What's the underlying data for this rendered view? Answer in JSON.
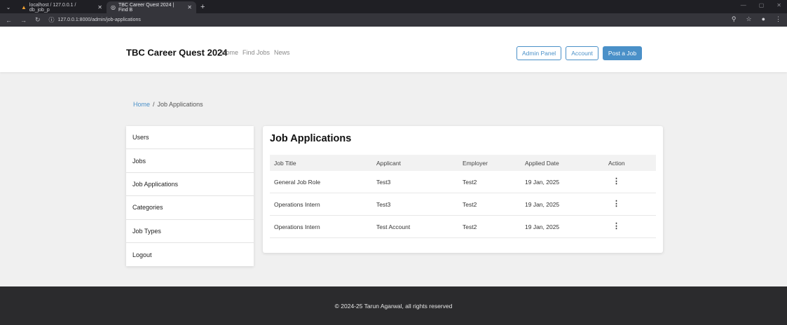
{
  "browser": {
    "tabs": [
      {
        "title": "localhost / 127.0.0.1 / db_job_p",
        "icon": "phpmyadmin-icon"
      },
      {
        "title": "TBC Career Quest 2024 | Find B",
        "icon": "globe-icon"
      }
    ],
    "url": "127.0.0.1:8000/admin/job-applications"
  },
  "site": {
    "brand": "TBC Career Quest 2024",
    "nav": [
      "Home",
      "Find Jobs",
      "News"
    ],
    "buttons": {
      "admin": "Admin Panel",
      "account": "Account",
      "post": "Post a Job"
    }
  },
  "breadcrumb": {
    "home": "Home",
    "sep": "/",
    "current": "Job Applications"
  },
  "sidebar": {
    "items": [
      "Users",
      "Jobs",
      "Job Applications",
      "Categories",
      "Job Types",
      "Logout"
    ]
  },
  "main": {
    "title": "Job Applications",
    "columns": [
      "Job Title",
      "Applicant",
      "Employer",
      "Applied Date",
      "Action"
    ],
    "rows": [
      [
        "General Job Role",
        "Test3",
        "Test2",
        "19 Jan, 2025"
      ],
      [
        "Operations Intern",
        "Test3",
        "Test2",
        "19 Jan, 2025"
      ],
      [
        "Operations Intern",
        "Test Account",
        "Test2",
        "19 Jan, 2025"
      ]
    ],
    "action_glyph": "⋮"
  },
  "footer": {
    "text": "© 2024-25 Tarun Agarwal, all rights reserved"
  },
  "colors": {
    "accent": "#4a90c8",
    "footer_bg": "#2b2b2d",
    "chrome_bg": "#1f1f24"
  }
}
